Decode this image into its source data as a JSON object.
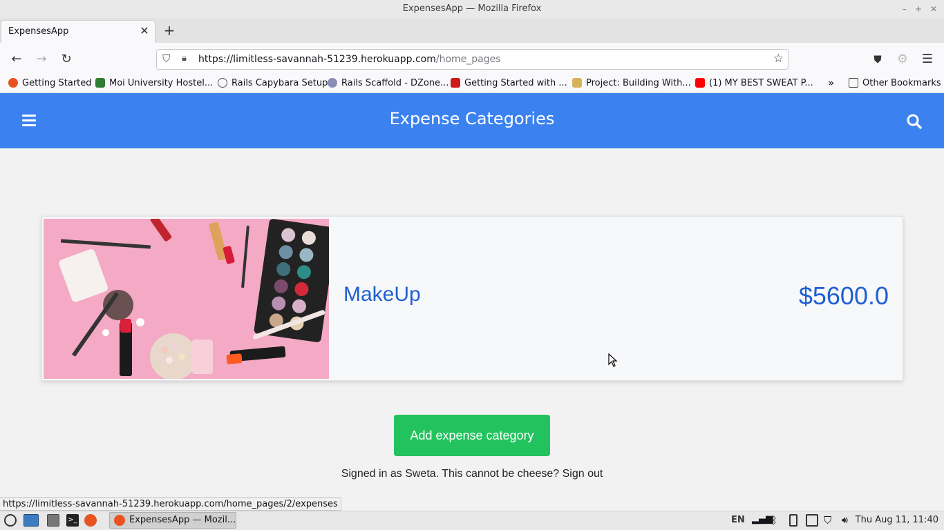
{
  "window": {
    "title": "ExpensesApp — Mozilla Firefox"
  },
  "tab": {
    "title": "ExpensesApp"
  },
  "nav": {
    "url_host": "https://limitless-savannah-51239.herokuapp.com",
    "url_path": "/home_pages"
  },
  "bookmarks": [
    {
      "label": "Getting Started",
      "color": "#e8541f"
    },
    {
      "label": "Moi University Hostel...",
      "color": "#2e7d32"
    },
    {
      "label": "Rails Capybara Setup",
      "color": "#555555"
    },
    {
      "label": "Rails Scaffold - DZone...",
      "color": "#8a8fb8"
    },
    {
      "label": "Getting Started with ...",
      "color": "#cc1b1b"
    },
    {
      "label": "Project: Building With...",
      "color": "#d6b25a"
    },
    {
      "label": "(1) MY BEST SWEAT P...",
      "color": "#ff0000"
    }
  ],
  "bookmarks_other": "Other Bookmarks",
  "header": {
    "title": "Expense Categories"
  },
  "category": {
    "name": "MakeUp",
    "amount": "$5600.0"
  },
  "actions": {
    "add_label": "Add expense category"
  },
  "footer": {
    "signed_in": "Signed in as Sweta. This cannot be cheese? Sign out"
  },
  "status_url": "https://limitless-savannah-51239.herokuapp.com/home_pages/2/expenses",
  "taskbar": {
    "app_label": "ExpensesApp — Mozil...",
    "lang": "EN",
    "clock": "Thu Aug 11, 11:40"
  }
}
